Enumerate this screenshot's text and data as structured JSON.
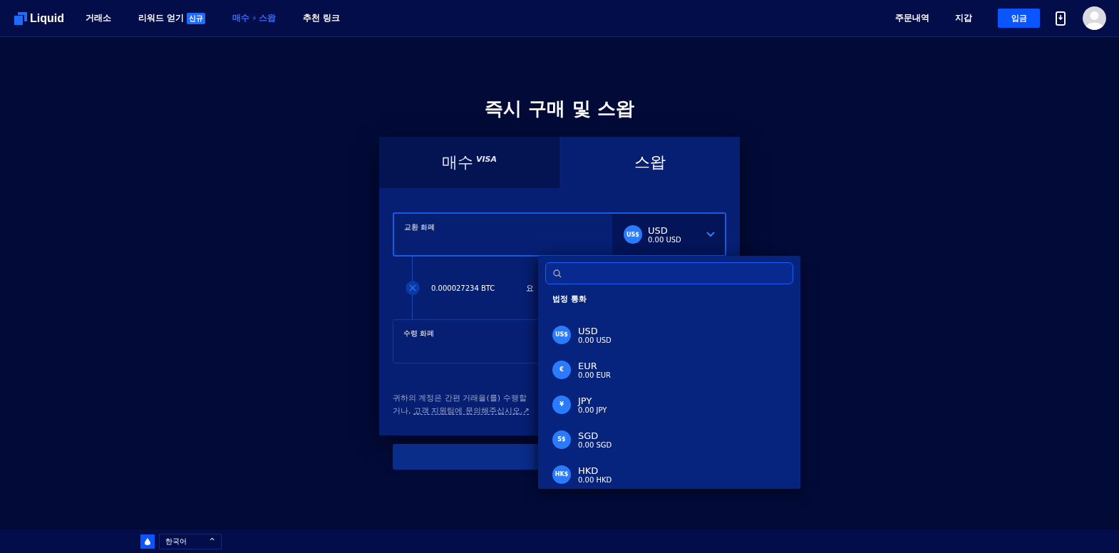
{
  "nav": {
    "logo": "Liquid",
    "items": [
      {
        "label": "거래소",
        "selected": false
      },
      {
        "label": "리워드 얻기",
        "badge": "신규",
        "selected": false
      },
      {
        "label": "매수",
        "icon": "⚡",
        "label2": "스왑",
        "selected": true
      },
      {
        "label": "추천 링크",
        "selected": false
      }
    ],
    "right_links": [
      "주문내역",
      "지갑"
    ],
    "deposit_button": "입금"
  },
  "title": "즉시 구매 및 스왑",
  "tabs": [
    {
      "label": "매수",
      "sup": "VISA",
      "selected": false
    },
    {
      "label": "스왑",
      "selected": true
    }
  ],
  "from_field": {
    "label": "교환 화폐",
    "currency": {
      "symbol": "US$",
      "code": "USD",
      "balance": "0.00 USD"
    }
  },
  "rate": {
    "value": "0.000027234 BTC",
    "fragment": "요"
  },
  "to_field": {
    "label": "수령 화폐"
  },
  "notice": {
    "line1": "귀하의 계정은 간편 거래을(를) 수행할",
    "line2_prefix": "거나, ",
    "link": "고객 지원팀에 문의해주십시오.↗"
  },
  "dropdown": {
    "group": "법정 통화",
    "items": [
      {
        "symbol": "US$",
        "code": "USD",
        "balance": "0.00 USD"
      },
      {
        "symbol": "€",
        "code": "EUR",
        "balance": "0.00 EUR"
      },
      {
        "symbol": "¥",
        "code": "JPY",
        "balance": "0.00 JPY"
      },
      {
        "symbol": "S$",
        "code": "SGD",
        "balance": "0.00 SGD"
      },
      {
        "symbol": "HK$",
        "code": "HKD",
        "balance": "0.00 HKD"
      }
    ]
  },
  "footer": {
    "language": "한국어",
    "caret": "^"
  }
}
